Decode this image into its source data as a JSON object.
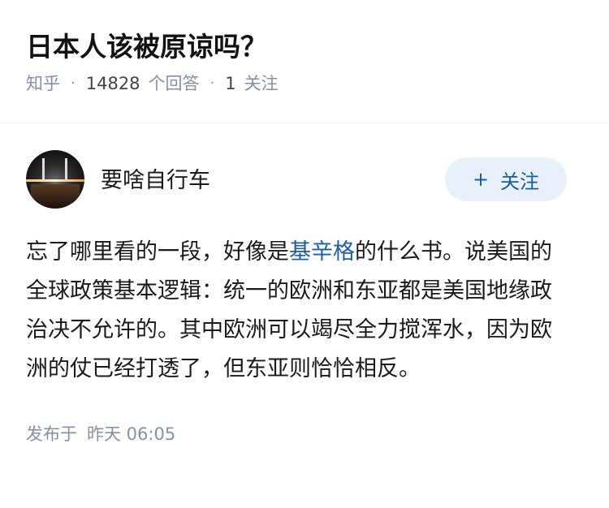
{
  "question": {
    "title": "日本人该被原谅吗？",
    "source": "知乎",
    "answer_count": "14828",
    "answer_label": "个回答",
    "follow_count": "1",
    "follow_label": "关注"
  },
  "answer": {
    "author": "要啥自行车",
    "follow_button": "关注",
    "follow_icon": "plus-icon",
    "content_before": "忘了哪里看的一段，好像是",
    "content_link": "基辛格",
    "content_after": "的什么书。说美国的全球政策基本逻辑：统一的欧洲和东亚都是美国地缘政治决不允许的。其中欧洲可以竭尽全力搅浑水，因为欧洲的仗已经打透了，但东亚则恰恰相反。",
    "published_label": "发布于",
    "published_time": "昨天 06:05"
  },
  "colors": {
    "link": "#1a5ea8",
    "follow_bg": "#e8f0fa",
    "meta_text": "#8590a6"
  }
}
